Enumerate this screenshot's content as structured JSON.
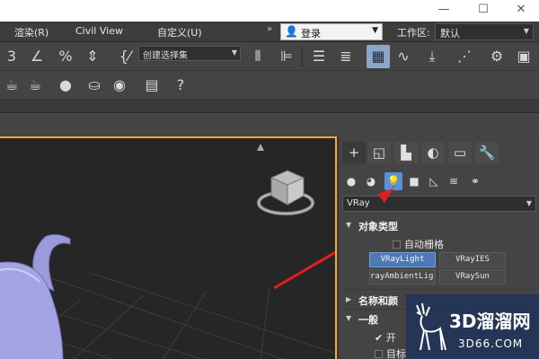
{
  "window_controls": {
    "minimize": "—",
    "maximize": "☐",
    "close": "✕"
  },
  "menubar": {
    "items": [
      {
        "label": "渲染(R)"
      },
      {
        "label": "Civil View"
      },
      {
        "label": "自定义(U)"
      }
    ],
    "expand": "»",
    "login": {
      "label": "登录"
    },
    "workspace": {
      "label": "工作区:",
      "value": "默认"
    }
  },
  "toolbar": {
    "selection_set_placeholder": "创建选择集"
  },
  "command_panel": {
    "type_dropdown": "VRay",
    "object_type": {
      "title": "对象类型",
      "auto_grid": "自动栅格",
      "buttons": [
        "VRayLight",
        "VRayIES",
        "rayAmbientLig",
        "VRaySun"
      ],
      "selected": "VRayLight"
    },
    "name_color": {
      "title": "名称和颜"
    },
    "general": {
      "title": "一般",
      "on_label": "开",
      "target_label": "目标"
    }
  },
  "watermark": {
    "brand": "3D溜溜网",
    "domain": "3D66.COM"
  },
  "colors": {
    "viewport_border": "#f0a830",
    "selected_button": "#4d79b7",
    "arrow": "#e02020"
  }
}
